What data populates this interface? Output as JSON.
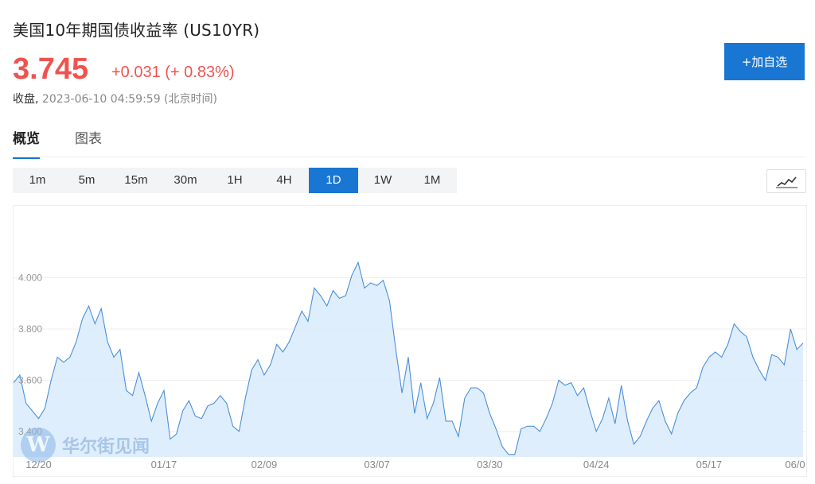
{
  "header": {
    "title": "美国10年期国债收益率 (US10YR)",
    "price": "3.745",
    "change": "+0.031 (+ 0.83%)",
    "status_label": "收盘,",
    "timestamp": "2023-06-10 04:59:59 (北京时间)",
    "add_button": "+加自选"
  },
  "colors": {
    "accent": "#1976d2",
    "up": "#ef5350",
    "line": "#4a90d9",
    "fill": "#d9ebfb"
  },
  "tabs": [
    {
      "label": "概览",
      "active": true
    },
    {
      "label": "图表",
      "active": false
    }
  ],
  "periods": [
    {
      "label": "1m",
      "active": false
    },
    {
      "label": "5m",
      "active": false
    },
    {
      "label": "15m",
      "active": false
    },
    {
      "label": "30m",
      "active": false
    },
    {
      "label": "1H",
      "active": false
    },
    {
      "label": "4H",
      "active": false
    },
    {
      "label": "1D",
      "active": true
    },
    {
      "label": "1W",
      "active": false
    },
    {
      "label": "1M",
      "active": false
    }
  ],
  "chart_type_icon": "line-chart-icon",
  "watermark": {
    "logo": "W",
    "text": "华尔街见闻"
  },
  "chart_data": {
    "type": "area",
    "ylim": [
      3.3,
      4.25
    ],
    "yticks": [
      "4.000",
      "3.800",
      "3.600",
      "3.400"
    ],
    "ytick_values": [
      4.0,
      3.8,
      3.6,
      3.4
    ],
    "xticks": [
      "12/20",
      "01/17",
      "02/09",
      "03/07",
      "03/30",
      "04/24",
      "05/17",
      "06/0"
    ],
    "xtick_index": [
      4,
      24,
      40,
      58,
      76,
      93,
      111,
      130
    ],
    "values": [
      3.59,
      3.62,
      3.51,
      3.48,
      3.45,
      3.49,
      3.6,
      3.69,
      3.67,
      3.69,
      3.75,
      3.84,
      3.89,
      3.82,
      3.88,
      3.75,
      3.69,
      3.72,
      3.56,
      3.54,
      3.63,
      3.54,
      3.44,
      3.51,
      3.56,
      3.37,
      3.39,
      3.48,
      3.52,
      3.46,
      3.45,
      3.5,
      3.51,
      3.54,
      3.51,
      3.42,
      3.4,
      3.53,
      3.64,
      3.68,
      3.62,
      3.66,
      3.74,
      3.71,
      3.75,
      3.81,
      3.87,
      3.83,
      3.96,
      3.93,
      3.89,
      3.95,
      3.92,
      3.93,
      4.01,
      4.06,
      3.96,
      3.98,
      3.97,
      3.99,
      3.91,
      3.72,
      3.55,
      3.69,
      3.47,
      3.59,
      3.45,
      3.51,
      3.61,
      3.44,
      3.44,
      3.38,
      3.53,
      3.57,
      3.57,
      3.55,
      3.47,
      3.41,
      3.34,
      3.31,
      3.31,
      3.41,
      3.42,
      3.42,
      3.4,
      3.45,
      3.51,
      3.6,
      3.58,
      3.59,
      3.54,
      3.57,
      3.48,
      3.4,
      3.45,
      3.53,
      3.43,
      3.58,
      3.44,
      3.35,
      3.38,
      3.44,
      3.49,
      3.52,
      3.44,
      3.39,
      3.47,
      3.52,
      3.55,
      3.57,
      3.65,
      3.69,
      3.71,
      3.69,
      3.74,
      3.82,
      3.79,
      3.77,
      3.69,
      3.64,
      3.6,
      3.7,
      3.69,
      3.66,
      3.8,
      3.72,
      3.745
    ]
  }
}
